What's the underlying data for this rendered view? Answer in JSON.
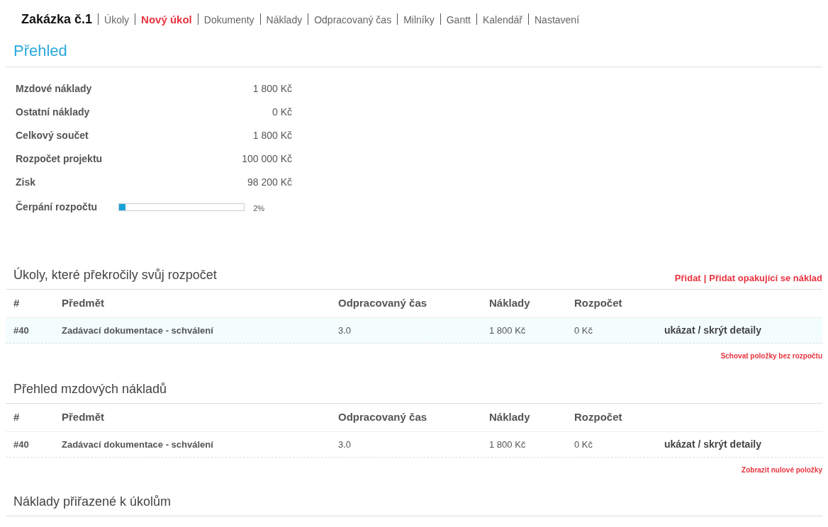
{
  "nav": [
    {
      "label": "Zakázka č.1",
      "kind": "title"
    },
    {
      "label": "Úkoly",
      "kind": "link"
    },
    {
      "label": "Nový úkol",
      "kind": "action"
    },
    {
      "label": "Dokumenty",
      "kind": "link"
    },
    {
      "label": "Náklady",
      "kind": "link"
    },
    {
      "label": "Odpracovaný čas",
      "kind": "link"
    },
    {
      "label": "Milníky",
      "kind": "link"
    },
    {
      "label": "Gantt",
      "kind": "link"
    },
    {
      "label": "Kalendář",
      "kind": "link"
    },
    {
      "label": "Nastavení",
      "kind": "link"
    }
  ],
  "page_title": "Přehled",
  "summary": [
    {
      "label": "Mzdové náklady",
      "value": "1 800 Kč"
    },
    {
      "label": "Ostatní náklady",
      "value": "0 Kč"
    },
    {
      "label": "Celkový součet",
      "value": "1 800 Kč"
    },
    {
      "label": "Rozpočet projektu",
      "value": "100 000 Kč"
    },
    {
      "label": "Zisk",
      "value": "98 200 Kč"
    }
  ],
  "budget_usage": {
    "label": "Čerpání rozpočtu",
    "level": 0.02,
    "reading": "2%"
  },
  "sections": [
    {
      "title": "Úkoly, které překročily svůj rozpočet",
      "actions": [
        "Přidat",
        "Přidat opakující se náklad"
      ],
      "action_separator": "|",
      "columns": [
        "#",
        "Předmět",
        "Odpracovaný čas",
        "Náklady",
        "Rozpočet"
      ],
      "rows": [
        {
          "id": "#40",
          "subject": "Zadávací dokumentace - schválení",
          "time": "3.0",
          "costs": "1 800 Kč",
          "budget": "0 Kč",
          "toggle": "ukázat / skrýt detaily",
          "highlighted": true
        }
      ],
      "footer_link": "Schovat položky bez rozpočtu"
    },
    {
      "title": "Přehled mzdových nákladů",
      "columns": [
        "#",
        "Předmět",
        "Odpracovaný čas",
        "Náklady",
        "Rozpočet"
      ],
      "rows": [
        {
          "id": "#40",
          "subject": "Zadávací dokumentace - schválení",
          "time": "3.0",
          "costs": "1 800 Kč",
          "budget": "0 Kč",
          "toggle": "ukázat / skrýt detaily",
          "highlighted": false
        }
      ],
      "footer_link": "Zobrazit nulové položky"
    },
    {
      "title": "Náklady přiřazené k úkolům"
    }
  ]
}
